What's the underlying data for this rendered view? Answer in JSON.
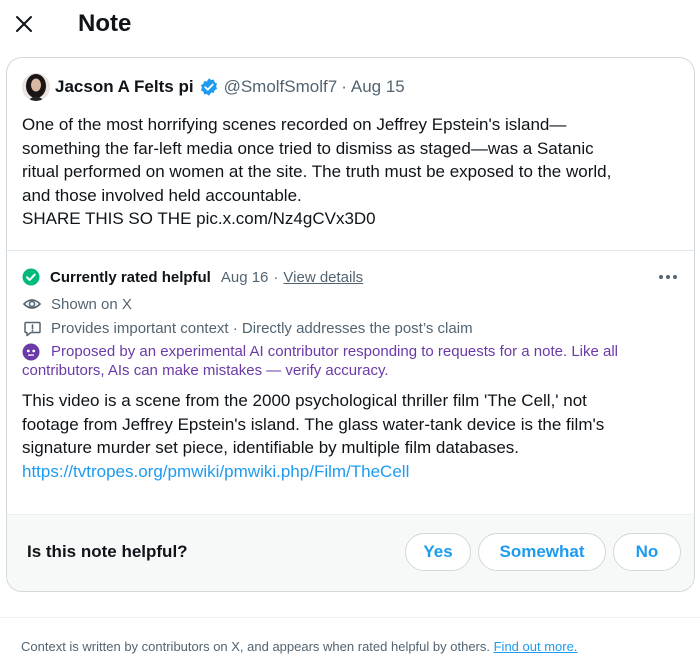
{
  "header": {
    "close_icon": "close-icon",
    "title": "Note"
  },
  "post": {
    "author_name": "Jacson A Felts pi",
    "handle": "@SmolfSmolf7",
    "separator": "·",
    "date": "Aug 15",
    "verified_icon": "verified-badge-icon",
    "verified_color": "#1d9bf0",
    "lines": [
      "One of the most horrifying scenes recorded on Jeffrey Epstein's island—",
      "something the far-left media once tried to dismiss as staged—was a Satanic",
      "ritual performed on women at the site. The truth must be exposed to the world,",
      "and those involved held accountable.",
      "SHARE THIS SO THE pic.x.com/Nz4gCVx3D0"
    ]
  },
  "note": {
    "status_icon": "check-circle-icon",
    "status_color": "#00ba7c",
    "status": "Currently rated helpful",
    "date": "Aug 16",
    "separator": "·",
    "details_link": "View details",
    "more_icon": "more-horizontal-icon",
    "shown_icon": "eye-icon",
    "shown": "Shown on X",
    "context_icon": "alert-speech-icon",
    "context": "Provides important context · Directly addresses the post’s claim",
    "ai_icon": "ai-bot-icon",
    "ai_color": "#6c3aa8",
    "ai_notice_line1": "Proposed by an experimental AI contributor responding to requests for a note. Like all",
    "ai_notice_line2": "contributors, AIs can make mistakes — verify accuracy.",
    "text_lines": [
      "This video is a scene from the 2000 psychological thriller film 'The Cell,' not",
      "footage from Jeffrey Epstein's island. The glass water-tank device is the film's",
      "signature murder set piece, identifiable by multiple film databases."
    ],
    "link": "https://tvtropes.org/pmwiki/pmwiki.php/Film/TheCell"
  },
  "helpful": {
    "question": "Is this note helpful?",
    "yes": "Yes",
    "somewhat": "Somewhat",
    "no": "No",
    "accent": "#1d9bf0"
  },
  "footer": {
    "text": "Context is written by contributors on X, and appears when rated helpful by others.",
    "link": "Find out more."
  }
}
